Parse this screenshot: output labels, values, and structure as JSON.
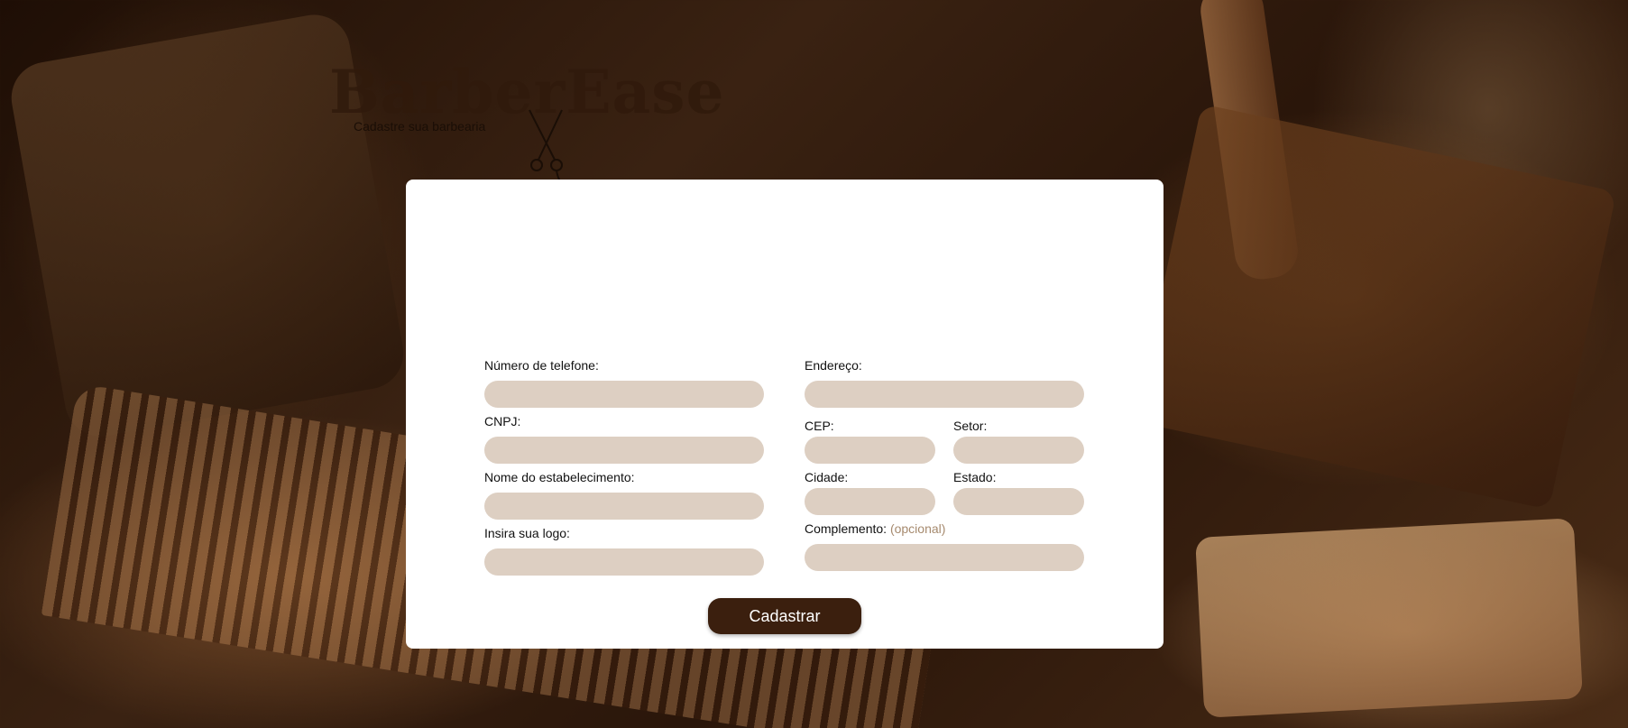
{
  "brand": {
    "name": "BarberEase",
    "tagline": "Cadastre sua barbearia"
  },
  "form": {
    "left": [
      {
        "key": "telefone",
        "label": "Número de telefone:",
        "value": ""
      },
      {
        "key": "cnpj",
        "label": "CNPJ:",
        "value": ""
      },
      {
        "key": "nome",
        "label": "Nome do estabelecimento:",
        "value": ""
      },
      {
        "key": "logo",
        "label": "Insira sua logo:",
        "value": ""
      }
    ],
    "endereco": {
      "label": "Endereço:",
      "value": ""
    },
    "cep": {
      "label": "CEP:",
      "value": ""
    },
    "setor": {
      "label": "Setor:",
      "value": ""
    },
    "cidade": {
      "label": "Cidade:",
      "value": ""
    },
    "estado": {
      "label": "Estado:",
      "value": ""
    },
    "complemento": {
      "label": "Complemento:",
      "optional": "(opcional)",
      "value": ""
    },
    "submit_label": "Cadastrar"
  },
  "colors": {
    "input_bg": "#ddcfc2",
    "button_bg": "#3b1f0e",
    "optional_text": "#a68a6e"
  }
}
